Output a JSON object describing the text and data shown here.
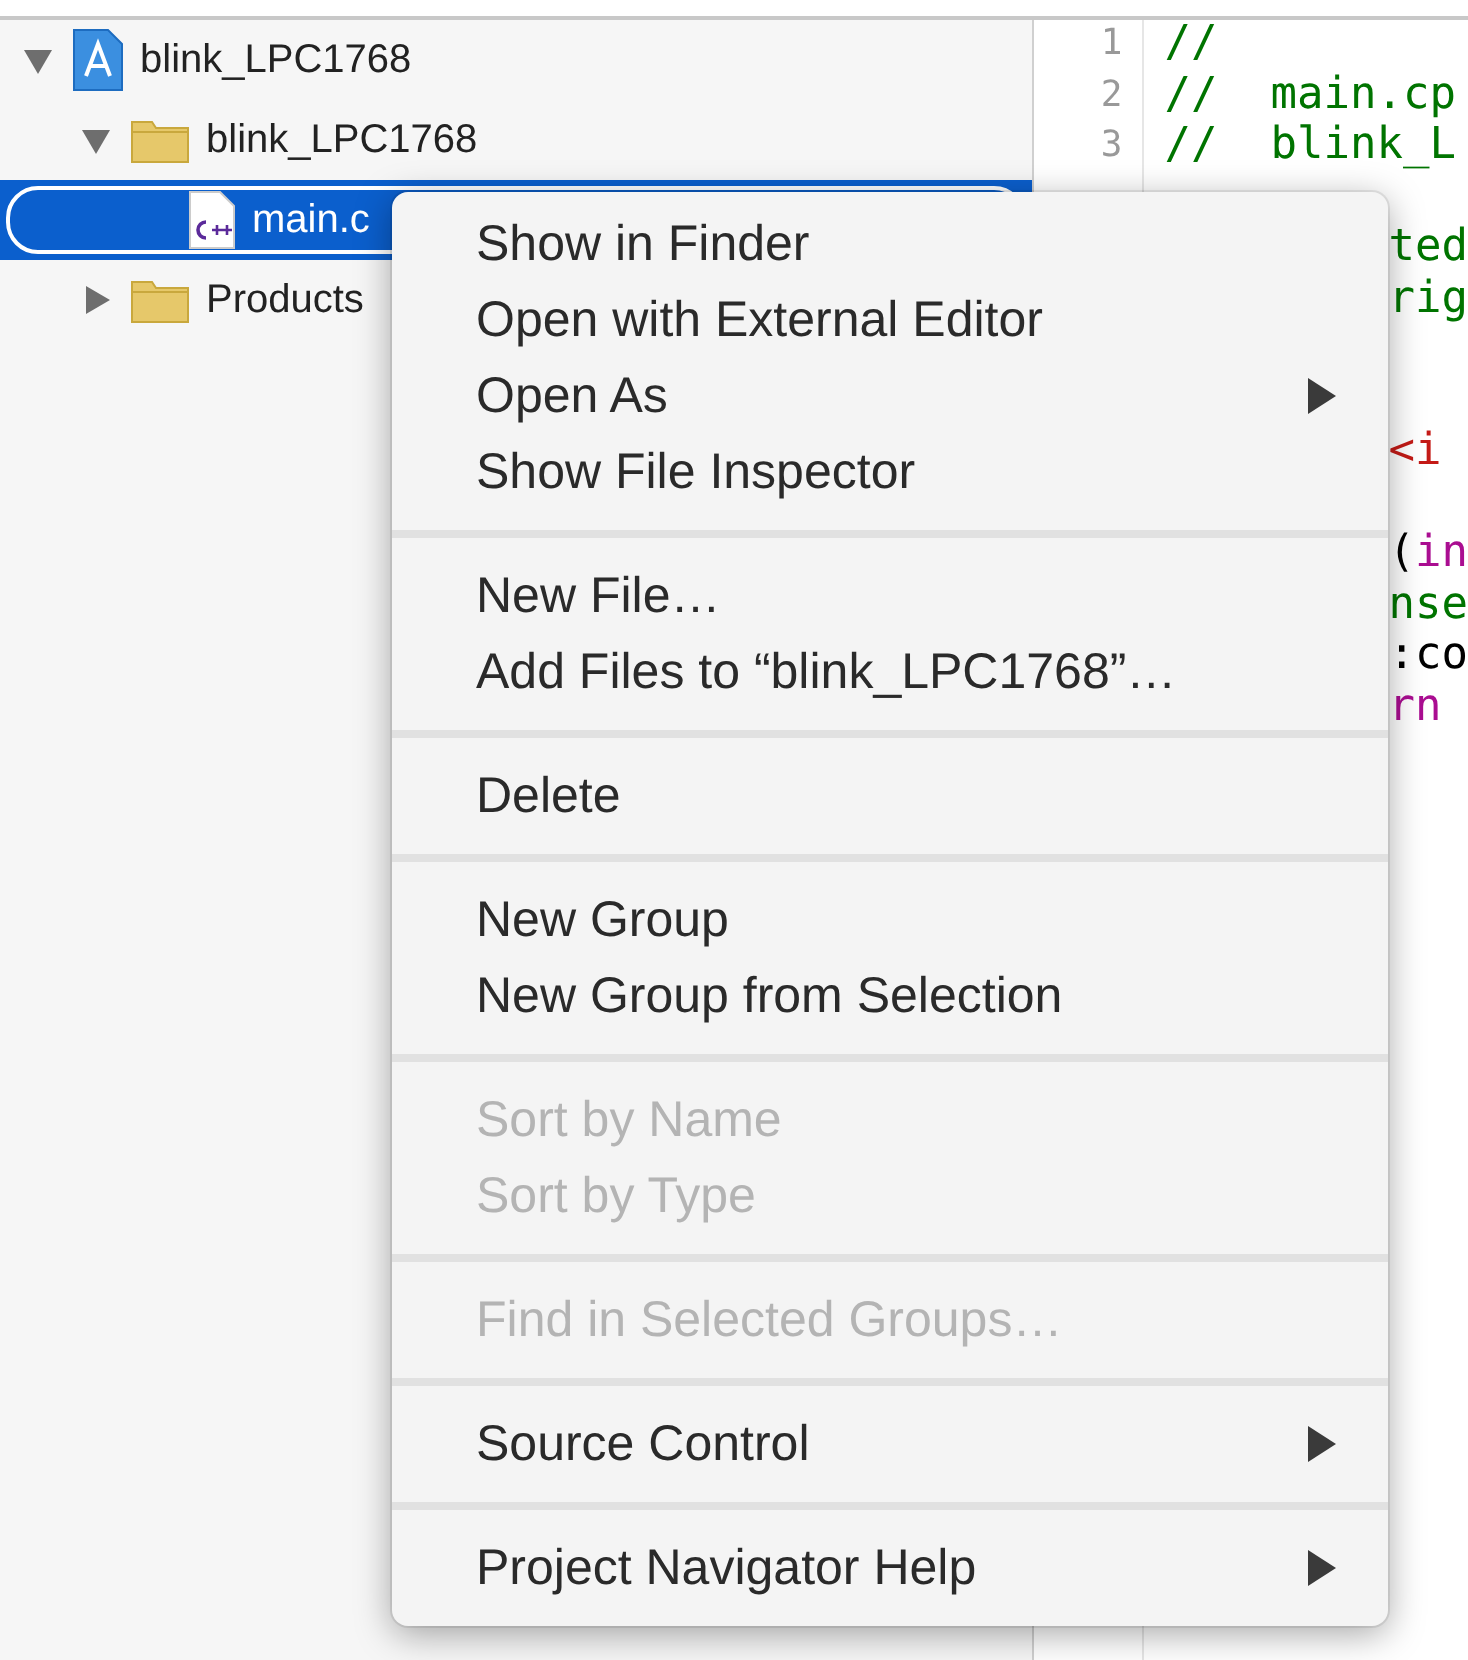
{
  "navigator": {
    "tree": [
      {
        "label": "blink_LPC1768",
        "kind": "project",
        "expanded": true,
        "selected": false,
        "children": [
          {
            "label": "blink_LPC1768",
            "kind": "group",
            "expanded": true,
            "selected": false,
            "children": [
              {
                "label": "main.c",
                "kind": "cpp-file",
                "selected": true
              }
            ]
          },
          {
            "label": "Products",
            "kind": "group",
            "expanded": false,
            "selected": false
          }
        ]
      }
    ]
  },
  "editor": {
    "lines": [
      {
        "number": "1",
        "kind": "full",
        "segments": [
          {
            "text": "//",
            "color": "#007400"
          }
        ]
      },
      {
        "number": "2",
        "kind": "full",
        "segments": [
          {
            "text": "//  main.cp",
            "color": "#007400"
          }
        ]
      },
      {
        "number": "3",
        "kind": "full",
        "segments": [
          {
            "text": "//  blink_L",
            "color": "#007400"
          }
        ]
      },
      {
        "kind": "hidden"
      },
      {
        "kind": "clipped",
        "segments": [
          {
            "text": "ted",
            "color": "#007400"
          }
        ]
      },
      {
        "kind": "clipped",
        "segments": [
          {
            "text": "rig",
            "color": "#007400"
          }
        ]
      },
      {
        "kind": "hidden"
      },
      {
        "kind": "hidden"
      },
      {
        "kind": "clipped",
        "segments": [
          {
            "text": "<i",
            "color": "#c41a16"
          }
        ]
      },
      {
        "kind": "hidden"
      },
      {
        "kind": "clipped",
        "segments": [
          {
            "text": "(",
            "color": "#000000"
          },
          {
            "text": "in",
            "color": "#aa0d91"
          }
        ]
      },
      {
        "kind": "clipped",
        "segments": [
          {
            "text": "nse",
            "color": "#007400"
          }
        ]
      },
      {
        "kind": "clipped",
        "segments": [
          {
            "text": ":co",
            "color": "#000000"
          }
        ]
      },
      {
        "kind": "clipped",
        "segments": [
          {
            "text": "rn",
            "color": "#aa0d91"
          }
        ]
      }
    ]
  },
  "context_menu": {
    "sections": [
      [
        {
          "label": "Show in Finder",
          "disabled": false,
          "submenu": false
        },
        {
          "label": "Open with External Editor",
          "disabled": false,
          "submenu": false
        },
        {
          "label": "Open As",
          "disabled": false,
          "submenu": true
        },
        {
          "label": "Show File Inspector",
          "disabled": false,
          "submenu": false
        }
      ],
      [
        {
          "label": "New File…",
          "disabled": false,
          "submenu": false
        },
        {
          "label": "Add Files to “blink_LPC1768”…",
          "disabled": false,
          "submenu": false
        }
      ],
      [
        {
          "label": "Delete",
          "disabled": false,
          "submenu": false
        }
      ],
      [
        {
          "label": "New Group",
          "disabled": false,
          "submenu": false
        },
        {
          "label": "New Group from Selection",
          "disabled": false,
          "submenu": false
        }
      ],
      [
        {
          "label": "Sort by Name",
          "disabled": true,
          "submenu": false
        },
        {
          "label": "Sort by Type",
          "disabled": true,
          "submenu": false
        }
      ],
      [
        {
          "label": "Find in Selected Groups…",
          "disabled": true,
          "submenu": false
        }
      ],
      [
        {
          "label": "Source Control",
          "disabled": false,
          "submenu": true
        }
      ],
      [
        {
          "label": "Project Navigator Help",
          "disabled": false,
          "submenu": true
        }
      ]
    ]
  }
}
